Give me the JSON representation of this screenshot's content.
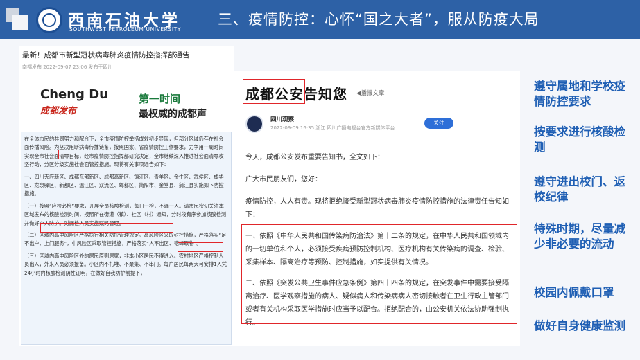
{
  "header": {
    "school_name_cn": "西南石油大学",
    "school_name_en": "SOUTHWEST PETROLEUM UNIVERSITY",
    "title": "三、疫情防控：心怀“国之大者”，服从防疫大局"
  },
  "left_doc": {
    "title": "最新！成都市新型冠状病毒肺炎疫情防控指挥部通告",
    "meta": "南都发布   2022-09-07 23:06  发布于四川",
    "brand_en": "Cheng Du",
    "brand_cn": "成都发布",
    "slogan1": "第一时间",
    "slogan2": "最权威的成都声",
    "para1": "在全体市民的共同努力和配合下，全市疫情防控举措成效初步显现，但部分区域仍存在社会面传播风险。为坚决阻断病毒传播链条，按照国家、省疫情防控工作要求，力争用一周时间实现全市社会面清零目标，经市疫情防控指挥部研究决定，全市继续深入推进社会面清零攻坚行动，分区分级实施社会面管控措施。现将有关事项通告如下：",
    "para2": "一、四川天府新区、成都东部新区、成都高新区、锦江区、青羊区、金牛区、武侯区、成华区、龙泉驿区、新都区、温江区、双流区、郫都区、简阳市、金堂县、蒲江县实施如下防控措施。",
    "para3": "（一）按照“应检必检”要求，开展全员核酸检测，每日一检，不漏一人。请市民密切关注本区域发布的核酸检测时间，按照所在街道（镇）、社区（村）通知，分时段有序参加核酸检测并做好个人防护。对漏检人员实施赋码管理。",
    "para4": "（二）区域内高中风险区严格执行相关防控管理规定。高风险区采取封控措施，严格落实“足不出户、上门服务”，中风险区采取管控措施，严格落实“人不出区、错峰取物”。",
    "para5": "（三）区域内高中风险区外的居民原则居家，非本小区居民不得进入。农村地区严格控制人员出入，外来人员必须报备。小区内不扎堆、不聚集、不串门。每户居民每两天可安排1人凭24小时内核酸检测阴性证明，在做好自我防护前提下，"
  },
  "right_doc": {
    "title_boxed": "成都公安",
    "title_rest": "告知您",
    "play_label": "播报文章",
    "author": "四川观察",
    "meta": "2022-09-09 16:35  浙江  四川广播电视台官方新媒体平台",
    "follow_label": "关注",
    "p1": "今天，成都公安发布重要告知书，全文如下：",
    "p2": "广大市民朋友们，您好：",
    "p3": "疫情防控，人人有责。现将拒绝接受新型冠状病毒肺炎疫情防控措施的法律责任告知如下：",
    "p4": "一、依照《中华人民共和国传染病防治法》第十二条的规定，在中华人民共和国领域内的一切单位和个人，必须接受疾病预防控制机构、医疗机构有关传染病的调查、检验、采集样本、隔离治疗等预防、控制措施，如实提供有关情况。",
    "p5": "二、依照《突发公共卫生事件应急条例》第四十四条的规定，在突发事件中需要接受隔离治疗、医学观察措施的病人、疑似病人和传染病病人密切接触者在卫生行政主管部门或者有关机构采取医学措施时应当予以配合。拒绝配合的，由公安机关依法协助强制执行。"
  },
  "bullets": [
    "遵守属地和学校疫情防控要求",
    "按要求进行核酸检测",
    "遵守进出校门、返校纪律",
    "特殊时期，尽量减少非必要的流动",
    "校园内佩戴口罩",
    "做好自身健康监测"
  ],
  "colors": {
    "header_bg": "#2d61a6",
    "bullet_text": "#1f5fb4",
    "highlight_box": "#e0262a",
    "follow_button": "#2e6fd8"
  }
}
